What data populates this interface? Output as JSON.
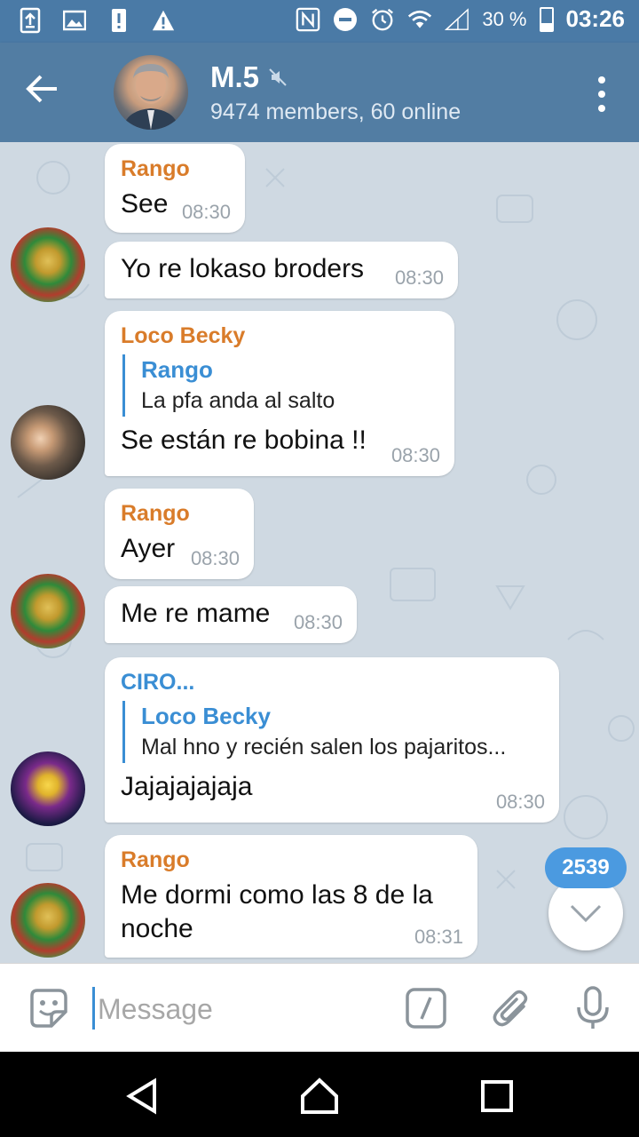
{
  "status_bar": {
    "battery_percent": "30 %",
    "time": "03:26",
    "icons": [
      "upload-icon",
      "image-icon",
      "alert-icon",
      "warning-icon",
      "nfc-icon",
      "dnd-icon",
      "alarm-icon",
      "wifi-icon",
      "signal-icon",
      "battery-icon"
    ]
  },
  "header": {
    "title": "M.5",
    "subtitle": "9474 members, 60 online",
    "muted": true
  },
  "messages": [
    {
      "sender": "Rango",
      "text": "See",
      "time": "08:30"
    },
    {
      "sender": "",
      "text": "Yo re lokaso broders",
      "time": "08:30"
    },
    {
      "sender": "Loco Becky",
      "reply_to": "Rango",
      "reply_text": "La pfa anda al salto",
      "text": "Se están re bobina !!",
      "time": "08:30"
    },
    {
      "sender": "Rango",
      "text": "Ayer",
      "time": "08:30"
    },
    {
      "sender": "",
      "text": "Me re mame",
      "time": "08:30"
    },
    {
      "sender": "CIRO...",
      "reply_to": "Loco Becky",
      "reply_text": "Mal hno y recién salen los pajaritos...",
      "text": "Jajajajajaja",
      "time": "08:30"
    },
    {
      "sender": "Rango",
      "text": "Me dormi como las 8 de la noche",
      "time": "08:31"
    }
  ],
  "unread_badge": "2539",
  "composer": {
    "placeholder": "Message"
  },
  "colors": {
    "header": "#527da3",
    "status_bar": "#4a7aa6",
    "sender_orange": "#d97c2a",
    "reply_blue": "#3a8ed4",
    "badge": "#4b9ae0"
  }
}
